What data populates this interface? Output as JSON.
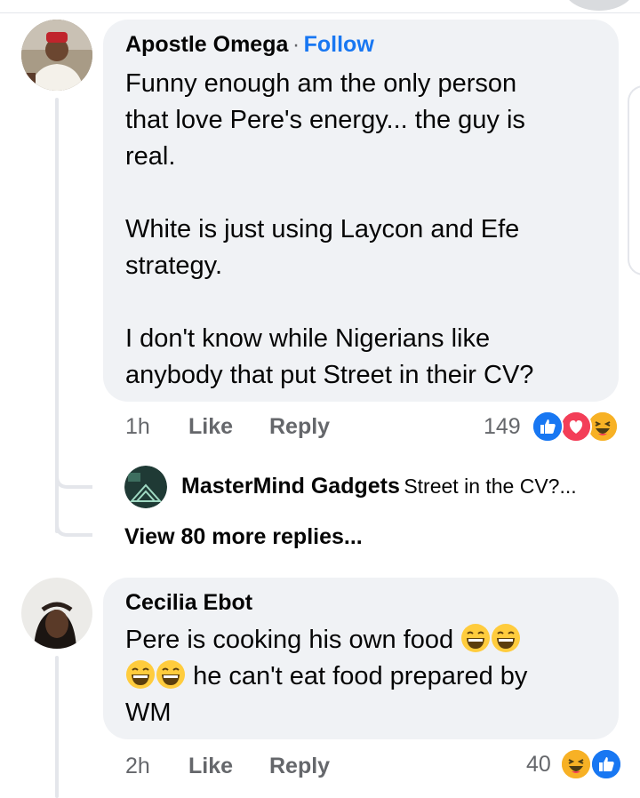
{
  "comment1": {
    "author": "Apostle Omega",
    "separator": "·",
    "follow_label": "Follow",
    "lines": [
      "Funny enough am the only person",
      "that love Pere's energy... the guy is",
      "real.",
      "",
      "White is just using Laycon and Efe",
      "strategy.",
      "",
      "I don't know while Nigerians like",
      "anybody that put Street in their CV?"
    ],
    "time": "1h",
    "like_label": "Like",
    "reply_label": "Reply",
    "reaction_count": "149",
    "reactions": [
      "like-icon",
      "love-icon",
      "haha-icon"
    ],
    "reply_preview": {
      "author": "MasterMind Gadgets",
      "text": "Street in the CV?..."
    },
    "view_more_label": "View 80 more replies..."
  },
  "comment2": {
    "author": "Cecilia Ebot",
    "line1": "Pere is cooking his own food",
    "line2": "he can't eat food prepared by",
    "line3": "WM",
    "emojis": [
      "grinning-squinting-face",
      "grinning-squinting-face",
      "grinning-squinting-face",
      "grinning-squinting-face"
    ],
    "time": "2h",
    "like_label": "Like",
    "reply_label": "Reply",
    "reaction_count": "40",
    "reactions": [
      "haha-icon",
      "like-icon"
    ]
  },
  "colors": {
    "link_blue": "#1877f2",
    "bubble_bg": "#f0f2f5",
    "meta_gray": "#65676b",
    "love_red": "#f33e58",
    "haha_yellow": "#f7b125"
  }
}
